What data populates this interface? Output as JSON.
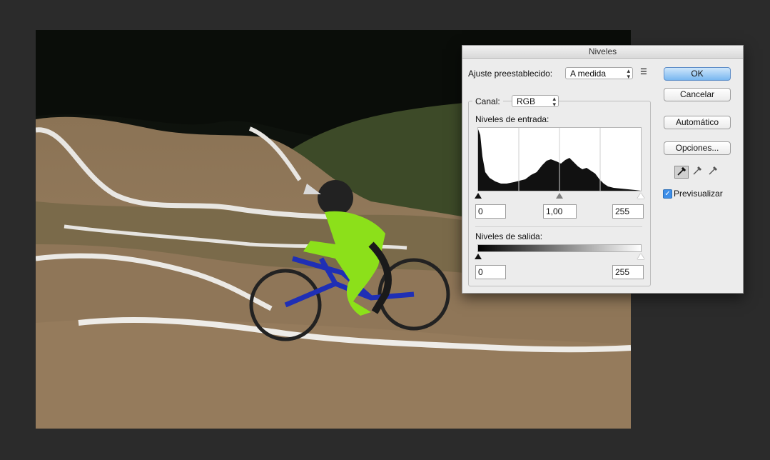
{
  "dialog": {
    "title": "Niveles",
    "preset_label": "Ajuste preestablecido:",
    "preset_value": "A medida",
    "channel_label": "Canal:",
    "channel_value": "RGB",
    "input_levels_label": "Niveles de entrada:",
    "input_black": "0",
    "input_gamma": "1,00",
    "input_white": "255",
    "output_levels_label": "Niveles de salida:",
    "output_black": "0",
    "output_white": "255",
    "buttons": {
      "ok": "OK",
      "cancel": "Cancelar",
      "auto": "Automático",
      "options": "Opciones..."
    },
    "preview_label": "Previsualizar",
    "preview_checked": true
  },
  "colors": {
    "workspace_bg": "#2b2b2b",
    "dialog_bg": "#ececec",
    "accent_blue": "#79b7f0"
  },
  "icons": [
    "menu-lines-icon",
    "black-eyedropper-icon",
    "gray-eyedropper-icon",
    "white-eyedropper-icon",
    "checkmark-icon"
  ]
}
